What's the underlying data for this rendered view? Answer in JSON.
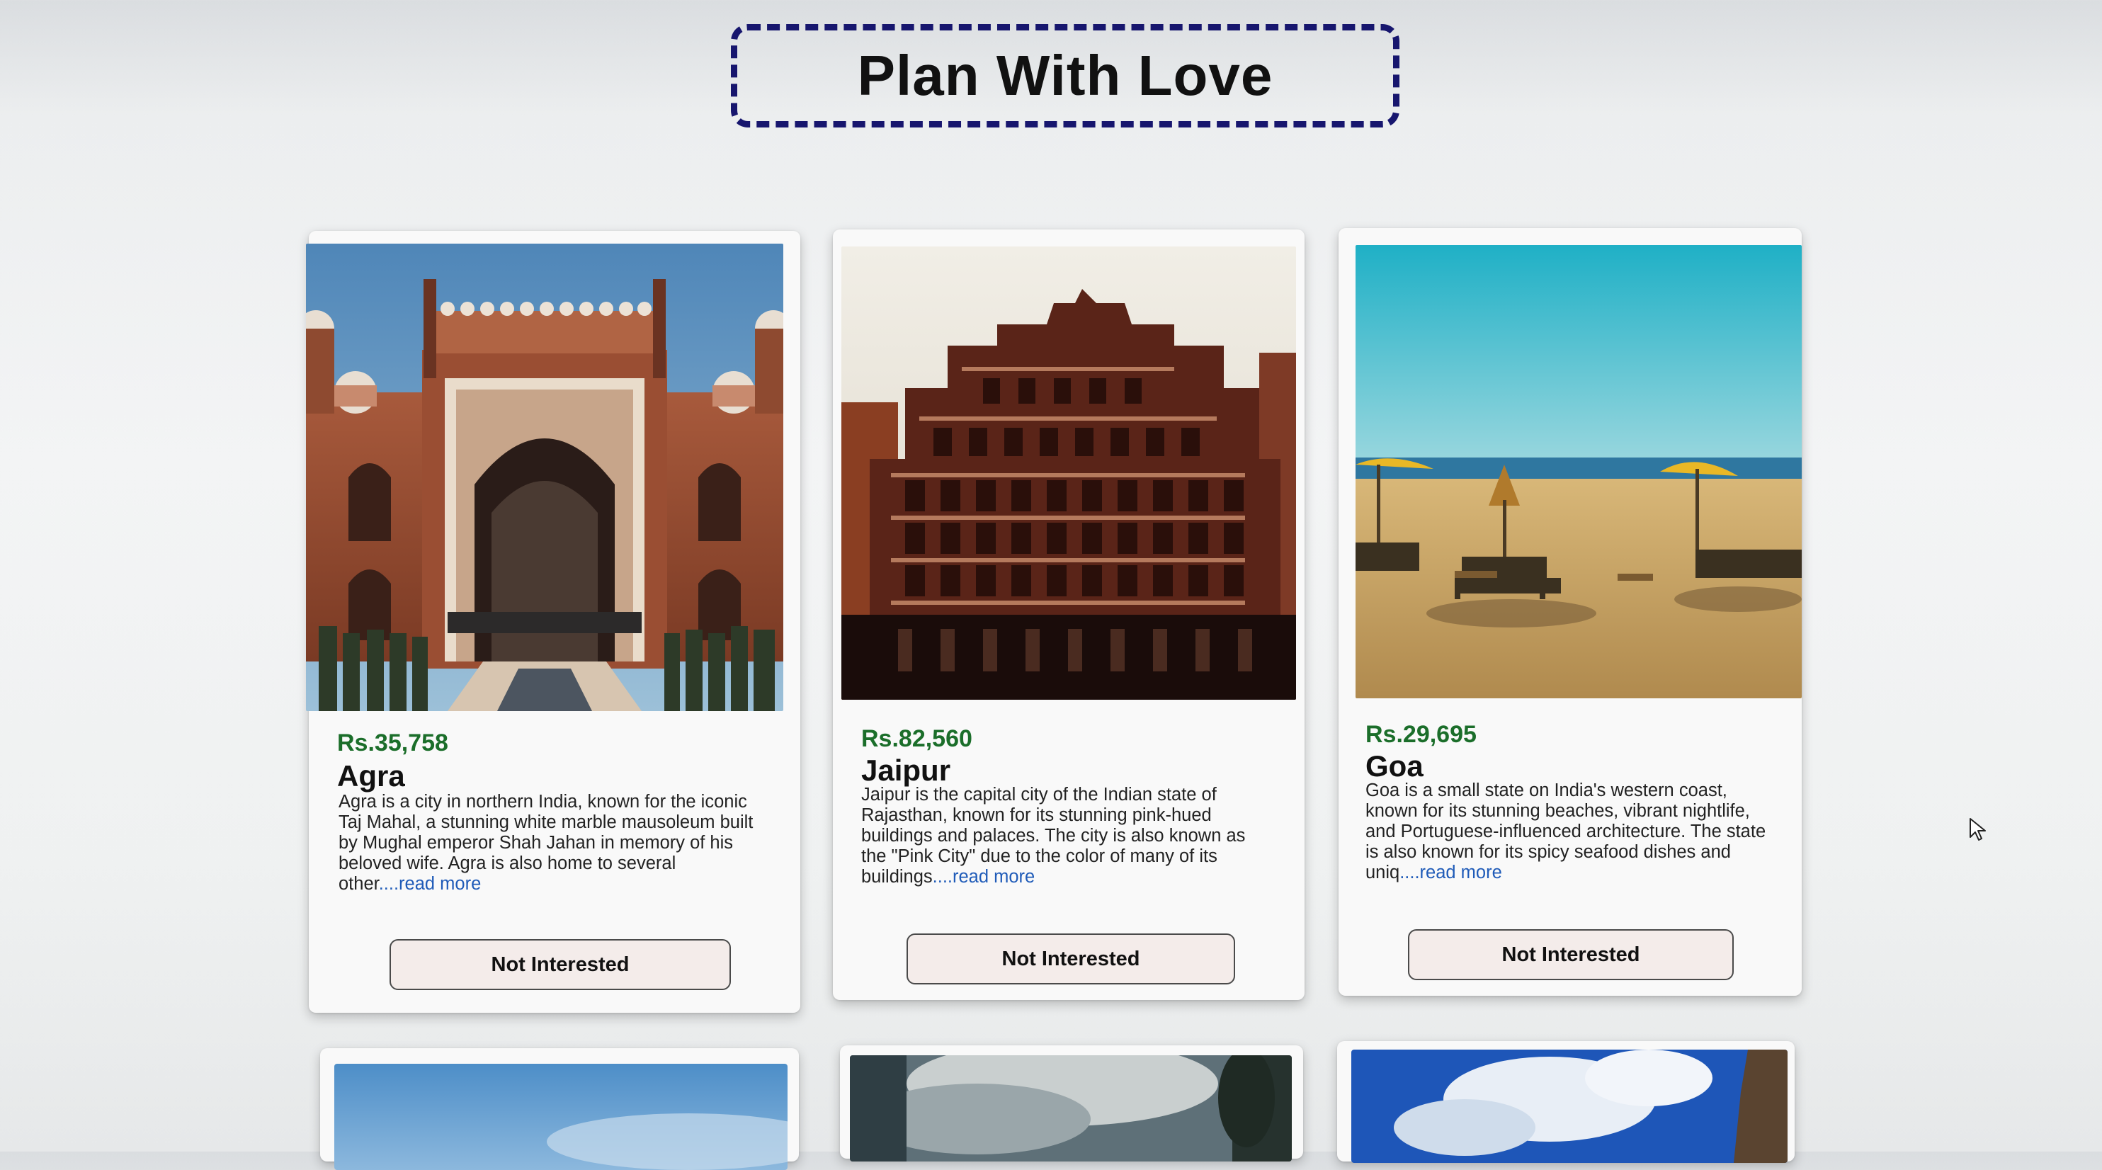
{
  "header": {
    "title": "Plan With Love"
  },
  "tours": [
    {
      "price": "Rs.35,758",
      "name": "Agra",
      "description": "Agra is a city in northern India, known for the iconic Taj Mahal, a stunning white marble mausoleum built by Mughal emperor Shah Jahan in memory of his beloved wife. Agra is also home to several other",
      "read_more": "....read more",
      "button_label": "Not Interested"
    },
    {
      "price": "Rs.82,560",
      "name": "Jaipur",
      "description": "Jaipur is the capital city of the Indian state of Rajasthan, known for its stunning pink-hued buildings and palaces. The city is also known as the \"Pink City\" due to the color of many of its buildings",
      "read_more": "....read more",
      "button_label": "Not Interested"
    },
    {
      "price": "Rs.29,695",
      "name": "Goa",
      "description": "Goa is a small state on India's western coast, known for its stunning beaches, vibrant nightlife, and Portuguese-influenced architecture. The state is also known for its spicy seafood dishes and uniq",
      "read_more": "....read more",
      "button_label": "Not Interested"
    }
  ],
  "colors": {
    "title_border": "#17166e",
    "price": "#1b6e2a",
    "read_more": "#1f5bb8",
    "button_bg": "#f4ecea"
  },
  "icons": {
    "cursor": "mouse-pointer-icon"
  }
}
